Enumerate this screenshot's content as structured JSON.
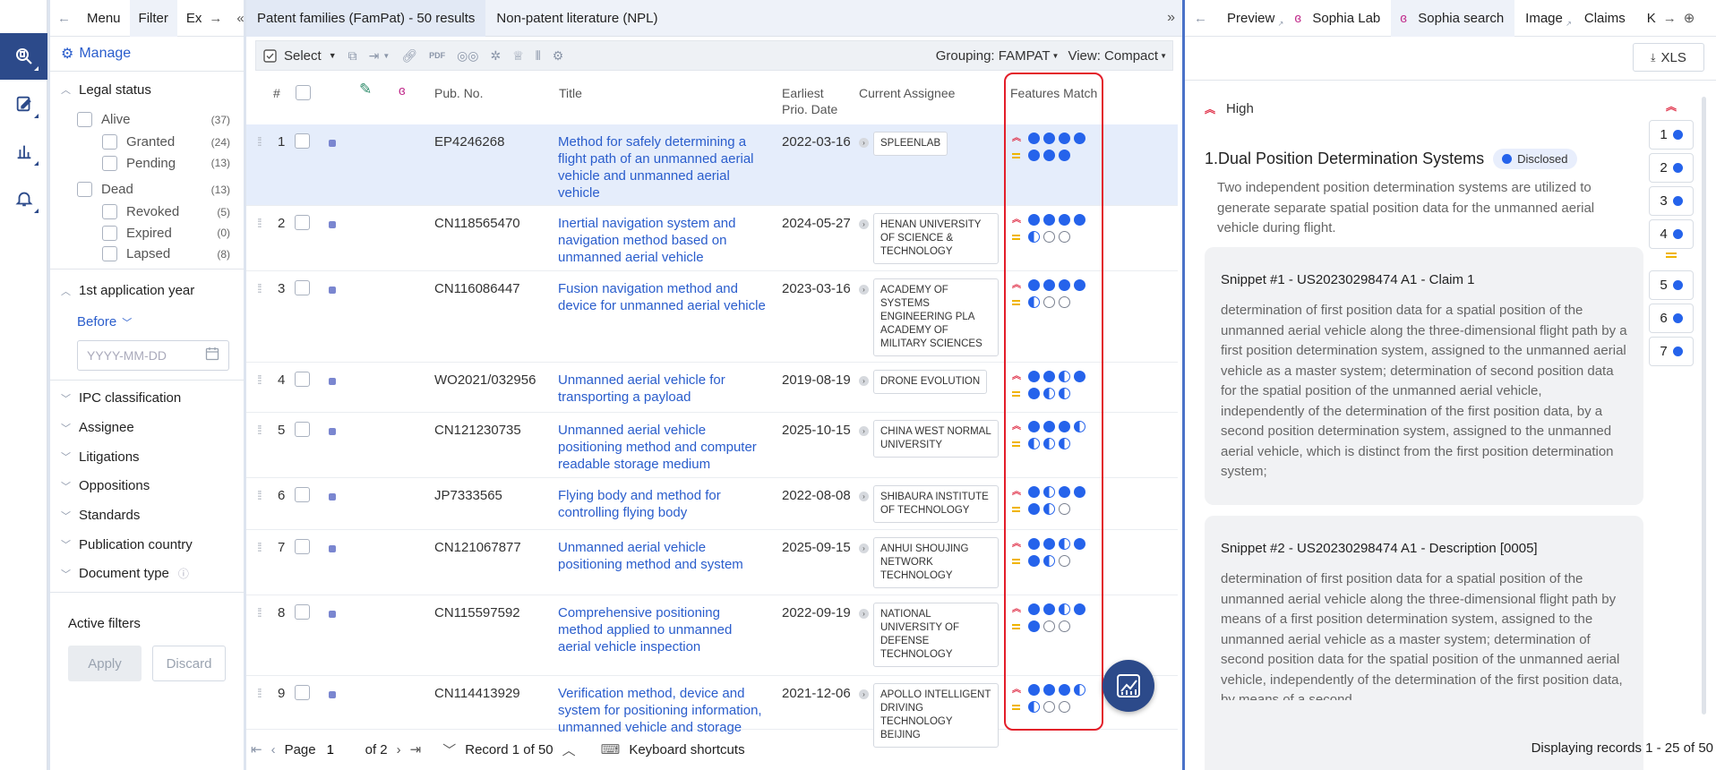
{
  "rail": {
    "items": [
      {
        "icon": "search-patent-icon",
        "active": true
      },
      {
        "icon": "edit-icon",
        "active": false
      },
      {
        "icon": "bar-chart-icon",
        "active": false
      },
      {
        "icon": "bell-icon",
        "active": false
      }
    ]
  },
  "filter_panel": {
    "tabs": [
      "Menu",
      "Filter",
      "Ex"
    ],
    "active_tab": "Filter",
    "manage_label": "Manage",
    "legal_status": {
      "title": "Legal status",
      "groups": [
        {
          "label": "Alive",
          "count": "(37)",
          "children": [
            {
              "label": "Granted",
              "count": "(24)"
            },
            {
              "label": "Pending",
              "count": "(13)"
            }
          ]
        },
        {
          "label": "Dead",
          "count": "(13)",
          "children": [
            {
              "label": "Revoked",
              "count": "(5)"
            },
            {
              "label": "Expired",
              "count": "(0)"
            },
            {
              "label": "Lapsed",
              "count": "(8)"
            }
          ]
        }
      ]
    },
    "application_year": {
      "title": "1st application year",
      "mode": "Before",
      "date_placeholder": "YYYY-MM-DD"
    },
    "sections": [
      "IPC classification",
      "Assignee",
      "Litigations",
      "Oppositions",
      "Standards",
      "Publication country",
      "Document type"
    ],
    "active_filters_label": "Active filters",
    "apply_label": "Apply",
    "discard_label": "Discard"
  },
  "center": {
    "tabs": [
      "Patent families (FamPat) - 50 results",
      "Non-patent literature (NPL)"
    ],
    "active_tab": 0,
    "toolbar": {
      "select_label": "Select",
      "grouping_label": "Grouping: FAMPAT",
      "view_label": "View: Compact"
    },
    "columns": {
      "num": "#",
      "pub": "Pub. No.",
      "title": "Title",
      "date": "Earliest Prio. Date",
      "assignee": "Current Assignee",
      "features": "Features Match"
    },
    "rows": [
      {
        "n": "1",
        "pub": "EP4246268",
        "title": "Method for safely determining a flight path of an unmanned aerial vehicle and unmanned aerial vehicle",
        "date": "2022-03-16",
        "assignee": "SPLEENLAB",
        "high": [
          "f",
          "f",
          "f",
          "f"
        ],
        "med": [
          "f",
          "f",
          "f"
        ],
        "selected": true
      },
      {
        "n": "2",
        "pub": "CN118565470",
        "title": "Inertial navigation system and navigation method based on unmanned aerial vehicle",
        "date": "2024-05-27",
        "assignee": "HENAN UNIVERSITY OF SCIENCE & TECHNOLOGY",
        "high": [
          "f",
          "f",
          "f",
          "f"
        ],
        "med": [
          "h",
          "e",
          "e"
        ]
      },
      {
        "n": "3",
        "pub": "CN116086447",
        "title": "Fusion navigation method and device for unmanned aerial vehicle",
        "date": "2023-03-16",
        "assignee": "ACADEMY OF SYSTEMS ENGINEERING PLA ACADEMY OF MILITARY SCIENCES",
        "high": [
          "f",
          "f",
          "f",
          "f"
        ],
        "med": [
          "h",
          "e",
          "e"
        ]
      },
      {
        "n": "4",
        "pub": "WO2021/032956",
        "title": "Unmanned aerial vehicle for transporting a payload",
        "date": "2019-08-19",
        "assignee": "DRONE EVOLUTION",
        "high": [
          "f",
          "f",
          "h",
          "f"
        ],
        "med": [
          "f",
          "h",
          "h"
        ]
      },
      {
        "n": "5",
        "pub": "CN121230735",
        "title": "Unmanned aerial vehicle positioning method and computer readable storage medium",
        "date": "2025-10-15",
        "assignee": "CHINA WEST NORMAL UNIVERSITY",
        "high": [
          "f",
          "f",
          "f",
          "h"
        ],
        "med": [
          "h",
          "h",
          "h"
        ]
      },
      {
        "n": "6",
        "pub": "JP7333565",
        "title": "Flying body and method for controlling flying body",
        "date": "2022-08-08",
        "assignee": "SHIBAURA INSTITUTE OF TECHNOLOGY",
        "high": [
          "f",
          "h",
          "f",
          "f"
        ],
        "med": [
          "f",
          "h",
          "e"
        ]
      },
      {
        "n": "7",
        "pub": "CN121067877",
        "title": "Unmanned aerial vehicle positioning method and system",
        "date": "2025-09-15",
        "assignee": "ANHUI SHOUJING NETWORK TECHNOLOGY",
        "high": [
          "f",
          "f",
          "h",
          "f"
        ],
        "med": [
          "f",
          "h",
          "e"
        ]
      },
      {
        "n": "8",
        "pub": "CN115597592",
        "title": "Comprehensive positioning method applied to unmanned aerial vehicle inspection",
        "date": "2022-09-19",
        "assignee": "NATIONAL UNIVERSITY OF DEFENSE TECHNOLOGY",
        "high": [
          "f",
          "f",
          "h",
          "f"
        ],
        "med": [
          "f",
          "e",
          "e"
        ]
      },
      {
        "n": "9",
        "pub": "CN114413929",
        "title": "Verification method, device and system for positioning information, unmanned vehicle and storage",
        "date": "2021-12-06",
        "assignee": "APOLLO INTELLIGENT DRIVING TECHNOLOGY BEIJING",
        "high": [
          "f",
          "f",
          "f",
          "h"
        ],
        "med": [
          "h",
          "e",
          "e"
        ]
      }
    ],
    "footer": {
      "page_label": "Page",
      "page_value": "1",
      "of_label": "of 2",
      "record_label": "Record 1 of 50",
      "shortcuts_label": "Keyboard shortcuts"
    }
  },
  "right": {
    "tabs": [
      "Preview",
      "Sophia Lab",
      "Sophia search",
      "Image",
      "Claims",
      "K"
    ],
    "active_tab": "Sophia search",
    "xls_label": "XLS",
    "high_label": "High",
    "feature": {
      "title": "1.Dual Position Determination Systems",
      "badge": "Disclosed",
      "description": "Two independent position determination systems are utilized to generate separate spatial position data for the unmanned aerial vehicle during flight."
    },
    "snippets": [
      {
        "title": "Snippet #1 - US20230298474 A1 - Claim 1",
        "text": "determination of first position data for a spatial position of the unmanned aerial vehicle along the three-dimensional flight path by a first position determination system, assigned to the unmanned aerial vehicle as a master system; determination of second position data for the spatial position of the unmanned aerial vehicle, independently of the determination of the first position data, by a second position determination system, assigned to the unmanned aerial vehicle, which is distinct from the first position determination system;"
      },
      {
        "title": "Snippet #2 - US20230298474 A1 - Description [0005]",
        "text": "determination of first position data for a spatial position of the unmanned aerial vehicle along the three-dimensional flight path by means of a first position determination system, assigned to the unmanned aerial vehicle as a master system; determination of second position data for the spatial position of the unmanned aerial vehicle, independently of the determination of the first position data, by means of a second"
      }
    ],
    "feature_numbers_high": [
      "1",
      "2",
      "3",
      "4"
    ],
    "feature_numbers_med": [
      "5",
      "6",
      "7"
    ],
    "footer": "Displaying records 1 - 25 of 50"
  }
}
